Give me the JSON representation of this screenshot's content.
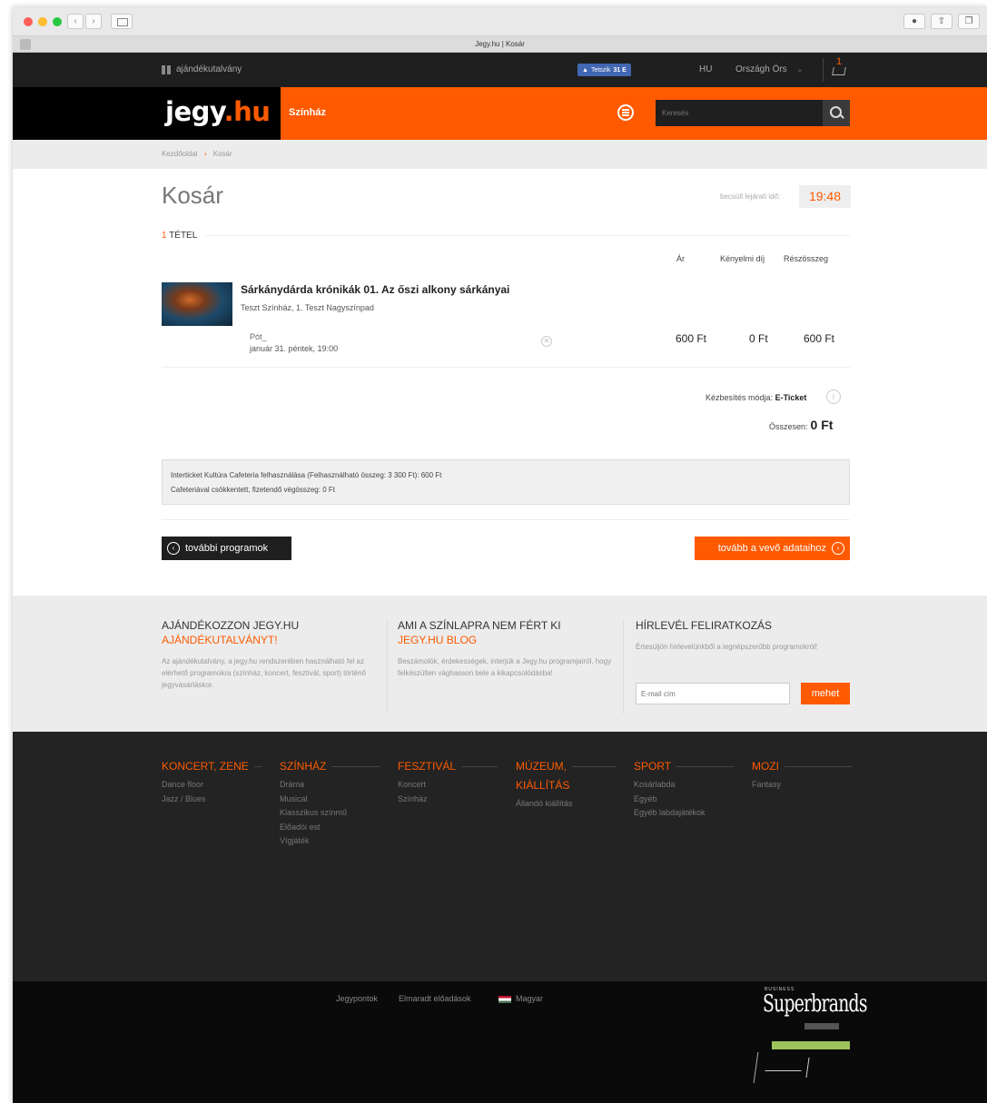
{
  "browser": {
    "tab_title": "Jegy.hu | Kosár",
    "traffic_colors": [
      "#ff5f57",
      "#febc2e",
      "#28c840"
    ],
    "back_icon": "chevron-left-icon",
    "forward_icon": "chevron-right-icon"
  },
  "topbar": {
    "gift_voucher": "ajándékutalvány",
    "fb_like_label": "Tetszik",
    "fb_like_count": "31 E",
    "language": "HU",
    "user": "Országh Örs",
    "user_caret": "⌄",
    "cart_count": "1"
  },
  "header": {
    "logo_main": "jegy",
    "logo_suffix": ".hu",
    "nav_item": "Színház",
    "search_placeholder": "Keresés",
    "accent_color": "#ff5a00"
  },
  "breadcrumb": {
    "home": "Kezdőoldal",
    "separator": "›",
    "current": "Kosár"
  },
  "cart": {
    "title": "Kosár",
    "timer_label": "becsült lejárati idő:",
    "timer_value": "19:48",
    "items_count": "1",
    "items_label": "TÉTEL",
    "columns": {
      "price": "Ár",
      "fee": "Kényelmi díj",
      "subtotal": "Részösszeg"
    },
    "item": {
      "title": "Sárkánydárda krónikák 01. Az őszi alkony sárkányai",
      "venue": "Teszt Színház, 1. Teszt Nagyszínpad",
      "seat": "Pót_",
      "date": "január 31. péntek, 19:00",
      "remove_symbol": "✕",
      "price": "600 Ft",
      "fee": "0 Ft",
      "subtotal": "600 Ft"
    },
    "delivery_label": "Kézbesítés módja:",
    "delivery_value": "E-Ticket",
    "info_symbol": "i",
    "total_label": "Összesen:",
    "total_value": "0 Ft",
    "cafeteria_line1": "Interticket Kultúra Cafeteria felhasználása (Felhasználható összeg: 3 300 Ft): 600 Ft",
    "cafeteria_line2": "Cafeteriával csökkentett, fizetendő végösszeg: 0 Ft",
    "back_button": "további programok",
    "next_button": "tovább a vevő adataihoz",
    "back_symbol": "‹",
    "next_symbol": "›"
  },
  "newsletter_band": {
    "col1_heading": "AJÁNDÉKOZZON JEGY.HU",
    "col1_sub": "AJÁNDÉKUTALVÁNYT!",
    "col1_text": "Az ajándékutalvány, a jegy.hu rendszerében használható fel az elérhető programokra (színház, koncert, fesztivál, sport) történő jegyvásárláskor.",
    "col2_heading": "AMI A SZÍNLAPRA NEM FÉRT KI",
    "col2_sub": "JEGY.HU BLOG",
    "col2_text": "Beszámolók, érdekességek, interjúk a Jegy.hu programjairól, hogy felkészülten vághasson bele a kikapcsolódásba!",
    "col3_heading": "HÍRLEVÉL FELIRATKOZÁS",
    "col3_text": "Értesüljön hírlevelünkből a legnépszerűbb programokról!",
    "email_placeholder": "E-mail cím",
    "submit": "mehet"
  },
  "categories": [
    {
      "title": "KONCERT, ZENE",
      "links": [
        "Dance floor",
        "Jazz / Blues"
      ]
    },
    {
      "title": "SZÍNHÁZ",
      "links": [
        "Dráma",
        "Musical",
        "Klasszikus színmű",
        "Előadói est",
        "Vígjáték"
      ]
    },
    {
      "title": "FESZTIVÁL",
      "links": [
        "Koncert",
        "Színház"
      ]
    },
    {
      "title": "MÚZEUM,",
      "title2": "KIÁLLÍTÁS",
      "links": [
        "Állandó kiállítás"
      ]
    },
    {
      "title": "SPORT",
      "links": [
        "Kosárlabda",
        "Egyéb",
        "Egyéb labdajátékok"
      ]
    },
    {
      "title": "MOZI",
      "links": [
        "Fantasy"
      ]
    }
  ],
  "footer": {
    "link1": "Jegypontok",
    "link2": "Elmaradt előadások",
    "language": "Magyar",
    "brand": "Superbrands",
    "brand_top": "BUSINESS"
  }
}
